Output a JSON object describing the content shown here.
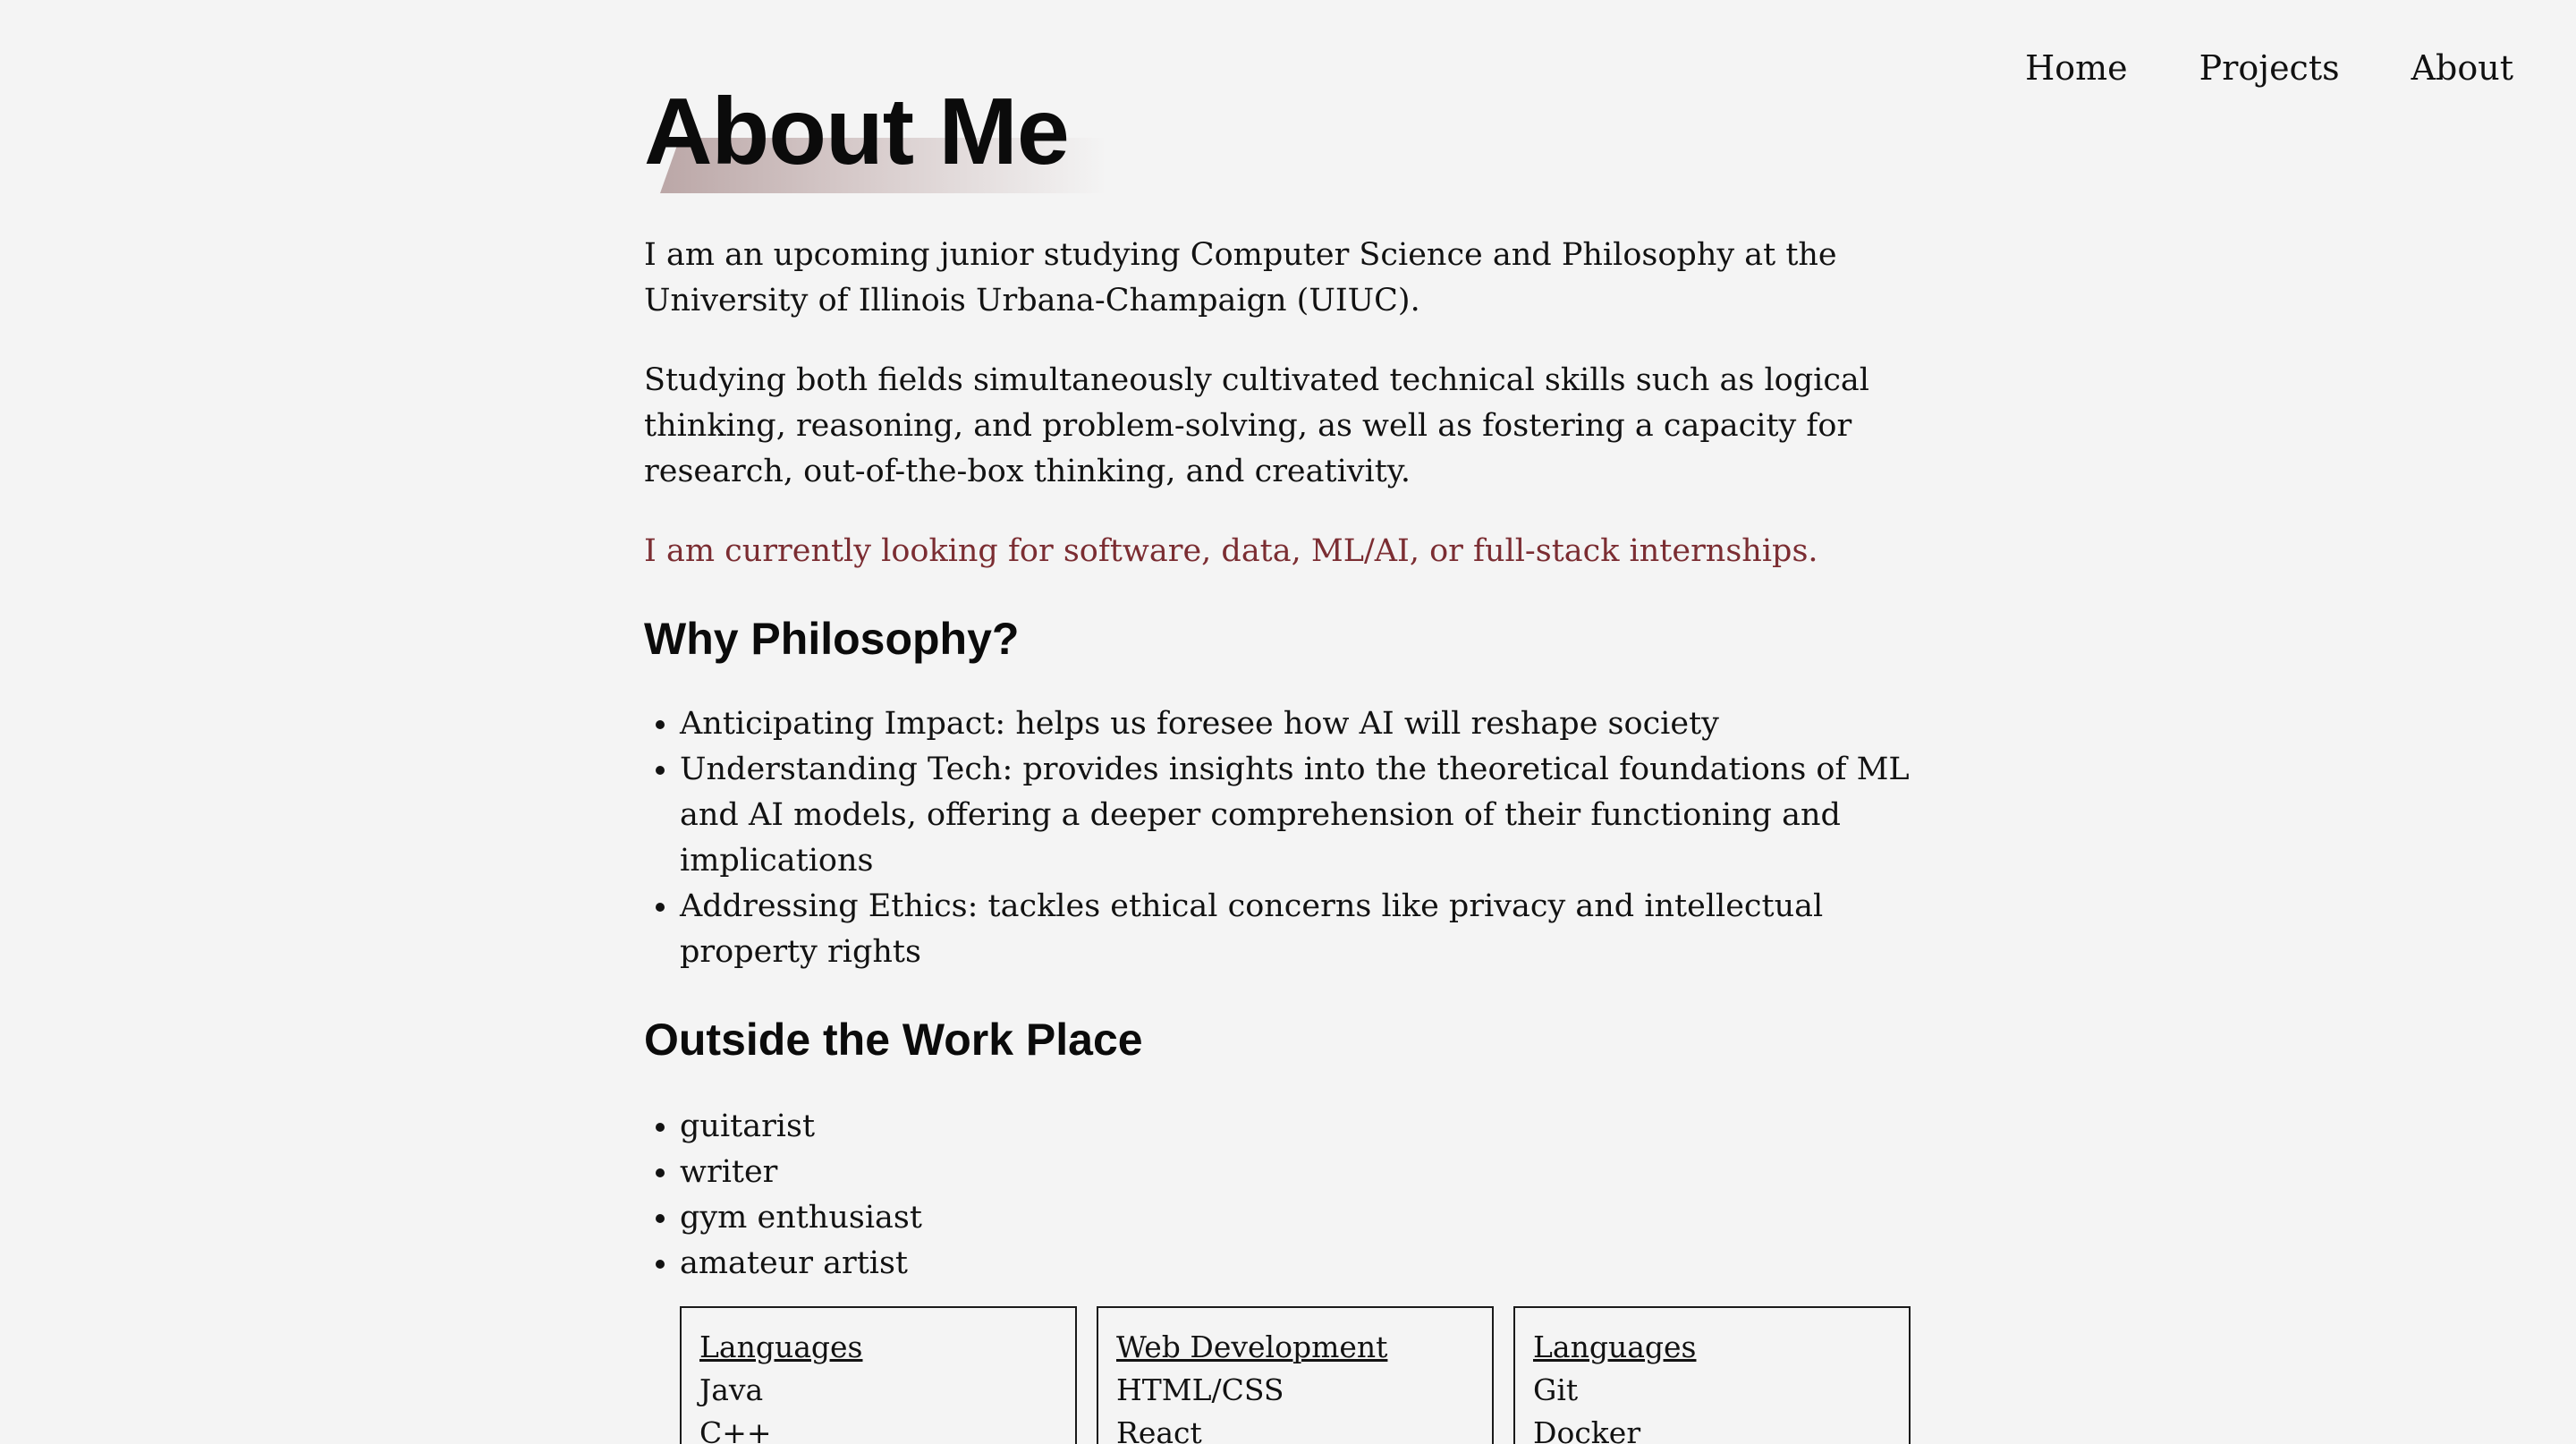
{
  "nav": {
    "items": [
      "Home",
      "Projects",
      "About"
    ]
  },
  "page": {
    "title": "About Me",
    "intro": "I am an upcoming junior studying Computer Science and Philosophy at the University of Illinois Urbana-Champaign (UIUC).",
    "studying": "Studying both fields simultaneously cultivated technical skills such as logical thinking, reasoning, and problem-solving, as well as fostering a capacity for research, out-of-the-box thinking, and creativity.",
    "looking": "I am currently looking for software, data, ML/AI, or full-stack internships."
  },
  "philosophy": {
    "heading": "Why Philosophy?",
    "items": [
      "Anticipating Impact: helps us foresee how AI will reshape society",
      "Understanding Tech: provides insights into the theoretical foundations of ML and AI models, offering a deeper comprehension of their functioning and implications",
      "Addressing Ethics: tackles ethical concerns like privacy and intellectual property rights"
    ]
  },
  "outside": {
    "heading": "Outside the Work Place",
    "items": [
      "guitarist",
      "writer",
      "gym enthusiast",
      "amateur artist"
    ]
  },
  "skills": [
    {
      "heading": "Languages",
      "items": [
        "Java",
        "C++"
      ]
    },
    {
      "heading": "Web Development",
      "items": [
        "HTML/CSS",
        "React"
      ]
    },
    {
      "heading": "Languages",
      "items": [
        "Git",
        "Docker"
      ]
    }
  ],
  "colors": {
    "background": "#f4f4f4",
    "highlight_text": "#7b2d32",
    "title_accent": "#bba7a7"
  }
}
